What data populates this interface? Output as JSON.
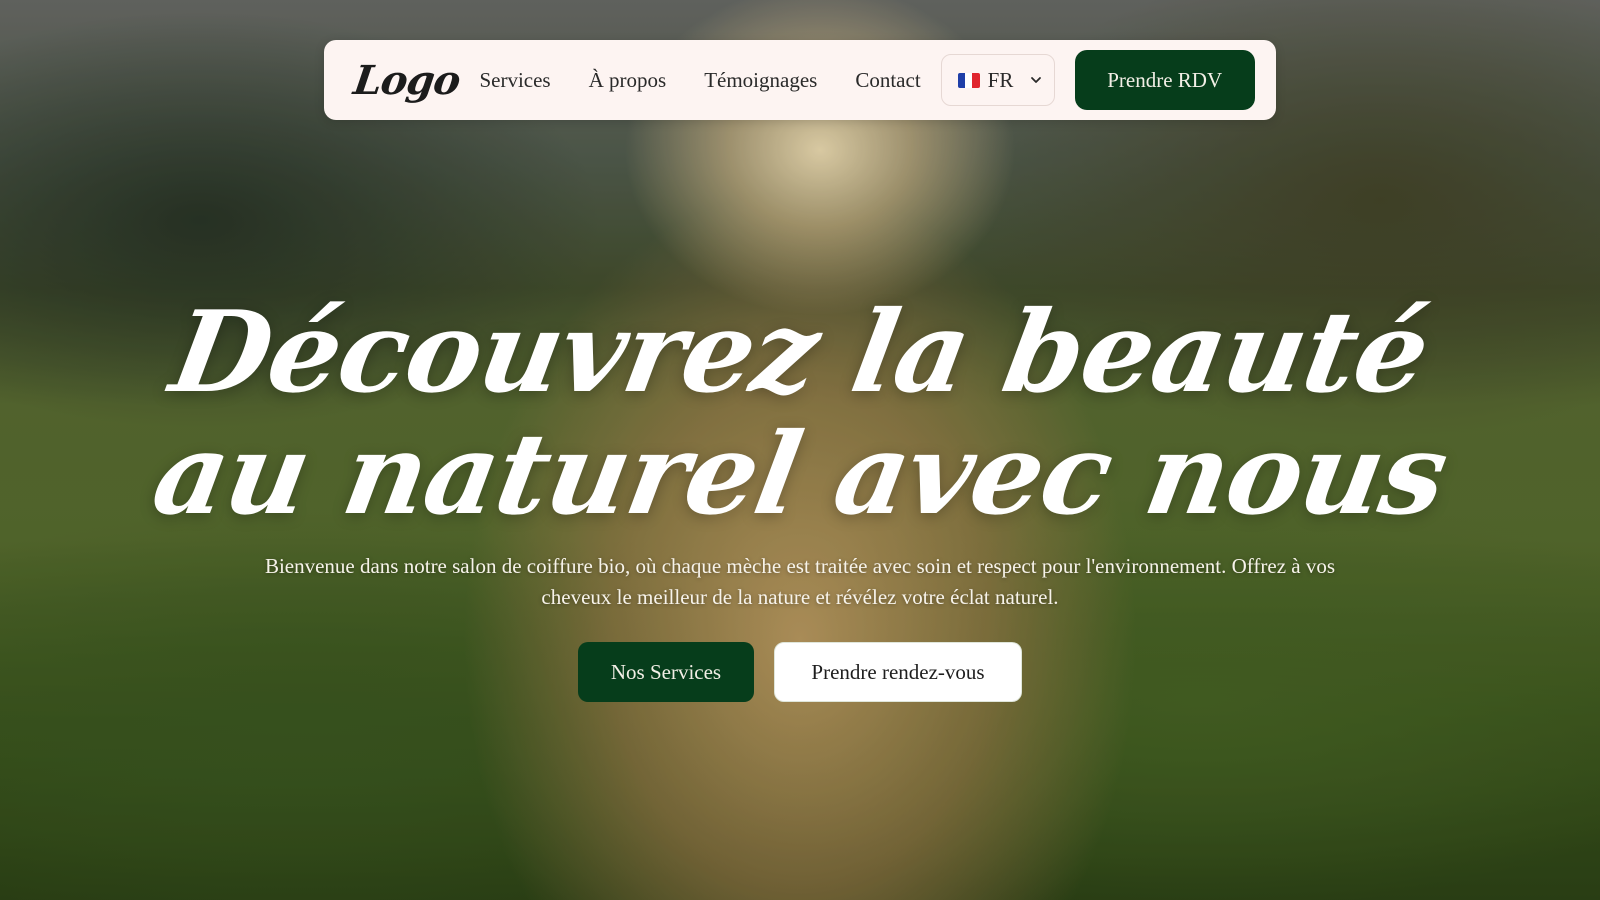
{
  "theme": {
    "primary_color": "#063d1b",
    "navbar_bg": "#fdf4f2",
    "hero_text_color": "#ffffff"
  },
  "navbar": {
    "logo": "Logo",
    "links": [
      "Services",
      "À propos",
      "Témoignages",
      "Contact"
    ],
    "language": {
      "selected": "FR",
      "flag_icon": "france-flag-icon",
      "dropdown_icon": "chevron-down-icon"
    },
    "cta_label": "Prendre RDV"
  },
  "hero": {
    "title_line1": "Découvrez la beauté",
    "title_line2": "au naturel avec nous",
    "subtitle": "Bienvenue dans notre salon de coiffure bio, où chaque mèche est traitée avec soin et respect pour l'environnement. Offrez à vos cheveux le meilleur de la nature et révélez votre éclat naturel.",
    "primary_button": "Nos Services",
    "secondary_button": "Prendre rendez-vous"
  }
}
